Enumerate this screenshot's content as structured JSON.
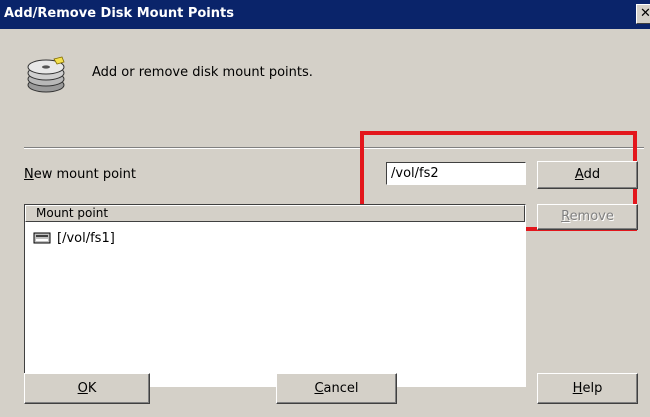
{
  "window": {
    "title": "Add/Remove Disk Mount Points",
    "close_glyph": "✕"
  },
  "header": {
    "icon": "disk-stack-icon",
    "description": "Add or remove disk mount points."
  },
  "new_mount": {
    "label_accel": "N",
    "label_rest": "ew mount point",
    "value": "/vol/fs2",
    "highlight_color": "#e3161c"
  },
  "buttons": {
    "add_accel": "A",
    "add_rest": "dd",
    "remove_accel": "R",
    "remove_rest": "emove",
    "ok_accel": "O",
    "ok_rest": "K",
    "cancel_accel": "C",
    "cancel_rest": "ancel",
    "help_accel": "H",
    "help_rest": "elp"
  },
  "list": {
    "column_header": "Mount point",
    "items": [
      {
        "label": "[/vol/fs1]",
        "icon": "drive-icon"
      }
    ]
  }
}
